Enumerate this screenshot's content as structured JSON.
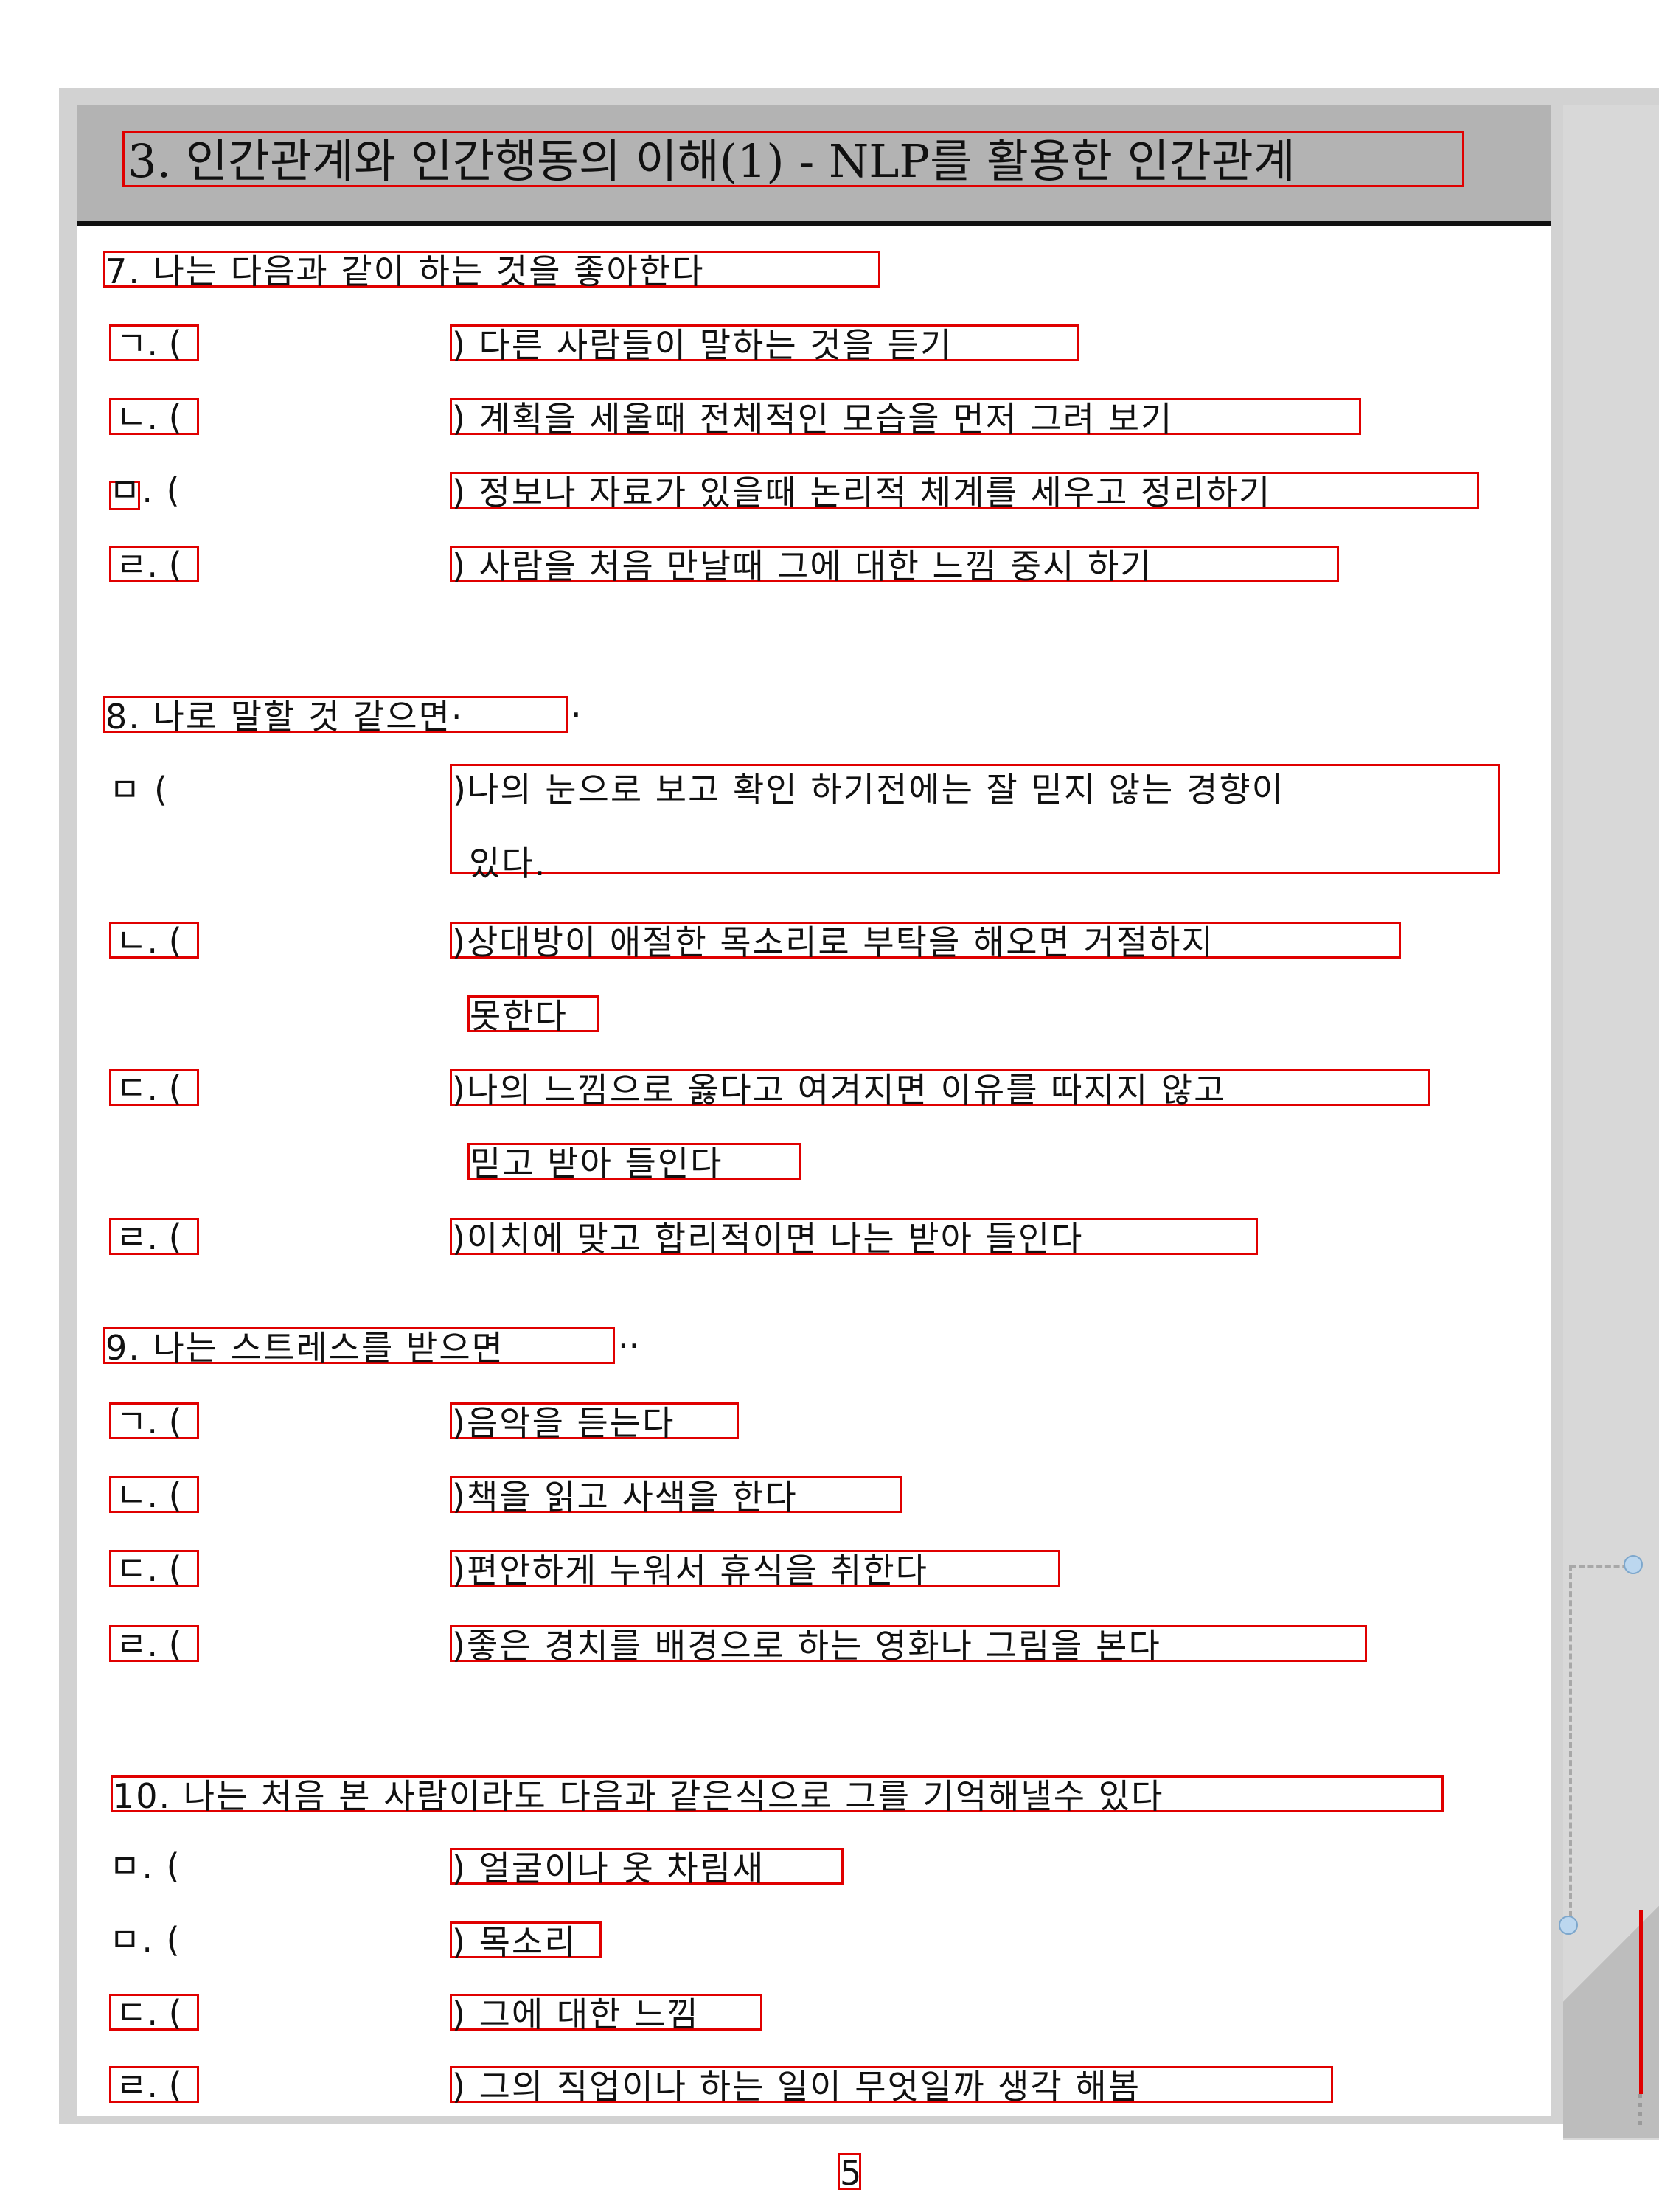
{
  "title": "3. 인간관계와 인간행동의 이해(1) - NLP를 활용한 인간관계",
  "sections": [
    {
      "question": "7. 나는 다음과 같이 하는 것을 좋아한다",
      "question_trail": "",
      "options": [
        {
          "label": "ㄱ. (",
          "text": ") 다른 사람들이 말하는 것을 듣기"
        },
        {
          "label": "ㄴ. (",
          "text": ") 계획을 세울때 전체적인 모습을 먼저 그려 보기"
        },
        {
          "label": "ㅁ. (",
          "text": ") 정보나 자료가 있을때 논리적 체계를 세우고 정리하기"
        },
        {
          "label": "ㄹ. (",
          "text": ") 사람을 처음 만날때 그에 대한 느낌 중시 하기"
        }
      ]
    },
    {
      "question": "8. 나로 말할 것 같으면·",
      "question_trail": "·",
      "options": [
        {
          "label": "ㅁ (",
          "text": ")나의 눈으로 보고 확인 하기전에는 잘 믿지 않는 경향이",
          "text2": "있다."
        },
        {
          "label": "ㄴ. (",
          "text": ")상대방이 애절한 목소리로 부탁을 해오면 거절하지",
          "text2": "못한다"
        },
        {
          "label": "ㄷ. (",
          "text": ")나의 느낌으로 옳다고 여겨지면 이유를 따지지 않고",
          "text2": "믿고 받아 들인다"
        },
        {
          "label": "ㄹ. (",
          "text": ")이치에 맞고 합리적이면 나는 받아 들인다"
        }
      ]
    },
    {
      "question": "9. 나는 스트레스를 받으면",
      "question_trail": "··",
      "options": [
        {
          "label": "ㄱ. (",
          "text": ")음악을 듣는다"
        },
        {
          "label": "ㄴ. (",
          "text": ")책을 읽고 사색을 한다"
        },
        {
          "label": "ㄷ. (",
          "text": ")편안하게 누워서 휴식을 취한다"
        },
        {
          "label": "ㄹ. (",
          "text": ")좋은 경치를 배경으로 하는 영화나 그림을 본다"
        }
      ]
    },
    {
      "question": "10. 나는 처음 본 사람이라도 다음과 같은식으로 그를 기억해낼수 있다",
      "question_trail": "",
      "options": [
        {
          "label": "ㅁ. (",
          "text": ") 얼굴이나 옷 차림새"
        },
        {
          "label": "ㅁ. (",
          "text": ") 목소리"
        },
        {
          "label": "ㄷ. (",
          "text": ") 그에 대한 느낌"
        },
        {
          "label": "ㄹ. (",
          "text": ") 그의 직업이나 하는 일이 무엇일까 생각 해봄"
        }
      ]
    }
  ],
  "page_number": "5"
}
